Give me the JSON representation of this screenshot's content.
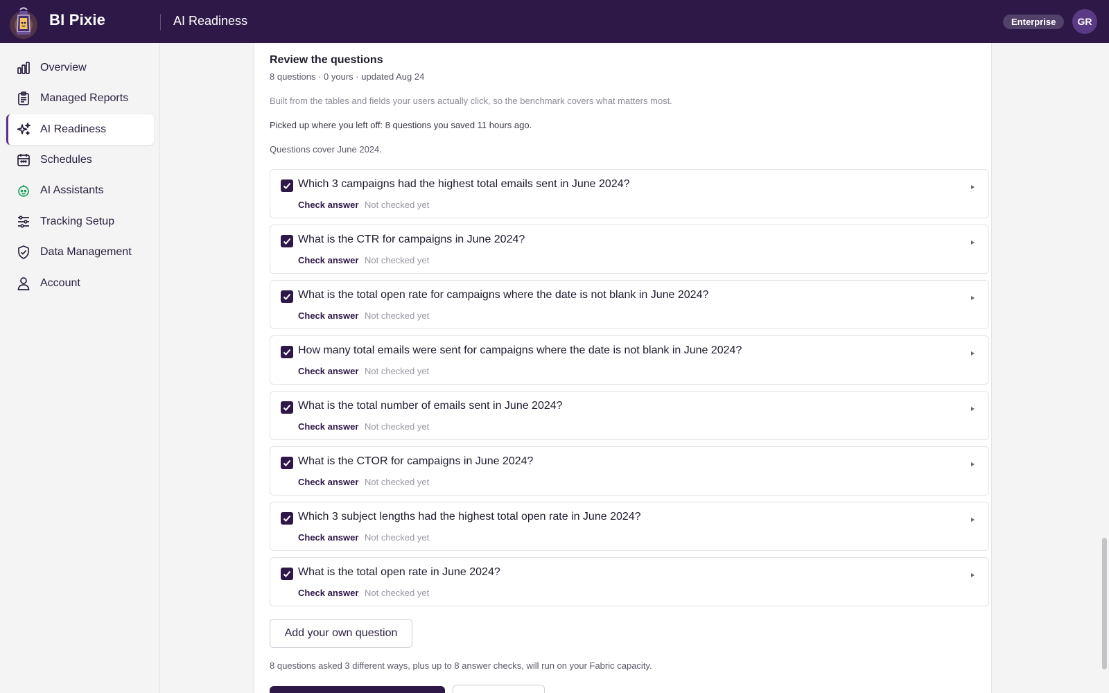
{
  "app": {
    "brand": "BI Pixie",
    "page_title": "AI Readiness",
    "plan_badge": "Enterprise",
    "avatar_initials": "GR",
    "colors": {
      "topbar": "#2d1847",
      "accent": "#5b2d91"
    }
  },
  "sidebar": {
    "items": [
      {
        "label": "Overview",
        "icon": "bar-chart-icon",
        "active": false
      },
      {
        "label": "Managed Reports",
        "icon": "clipboard-icon",
        "active": false
      },
      {
        "label": "AI Readiness",
        "icon": "sparkles-icon",
        "active": true
      },
      {
        "label": "Schedules",
        "icon": "calendar-icon",
        "active": false
      },
      {
        "label": "AI Assistants",
        "icon": "robot-icon",
        "active": false
      },
      {
        "label": "Tracking Setup",
        "icon": "sliders-icon",
        "active": false
      },
      {
        "label": "Data Management",
        "icon": "shield-check-icon",
        "active": false
      },
      {
        "label": "Account",
        "icon": "user-icon",
        "active": false
      }
    ]
  },
  "review": {
    "title": "Review the questions",
    "meta": "8 questions · 0 yours · updated Aug 24",
    "description": "Built from the tables and fields your users actually click, so the benchmark covers what matters most.",
    "resume_note": "Picked up where you left off: 8 questions you saved 11 hours ago.",
    "coverage": "Questions cover June 2024.",
    "questions": [
      {
        "text": "Which 3 campaigns had the highest total emails sent in June 2024?",
        "check_label": "Check answer",
        "status": "Not checked yet",
        "checked": true
      },
      {
        "text": "What is the CTR for campaigns in June 2024?",
        "check_label": "Check answer",
        "status": "Not checked yet",
        "checked": true
      },
      {
        "text": "What is the total open rate for campaigns where the date is not blank in June 2024?",
        "check_label": "Check answer",
        "status": "Not checked yet",
        "checked": true
      },
      {
        "text": "How many total emails were sent for campaigns where the date is not blank in June 2024?",
        "check_label": "Check answer",
        "status": "Not checked yet",
        "checked": true
      },
      {
        "text": "What is the total number of emails sent in June 2024?",
        "check_label": "Check answer",
        "status": "Not checked yet",
        "checked": true
      },
      {
        "text": "What is the CTOR for campaigns in June 2024?",
        "check_label": "Check answer",
        "status": "Not checked yet",
        "checked": true
      },
      {
        "text": "Which 3 subject lengths had the highest total open rate in June 2024?",
        "check_label": "Check answer",
        "status": "Not checked yet",
        "checked": true
      },
      {
        "text": "What is the total open rate in June 2024?",
        "check_label": "Check answer",
        "status": "Not checked yet",
        "checked": true
      }
    ],
    "add_button": "Add your own question",
    "footer_note": "8 questions asked 3 different ways, plus up to 8 answer checks, will run on your Fabric capacity."
  }
}
